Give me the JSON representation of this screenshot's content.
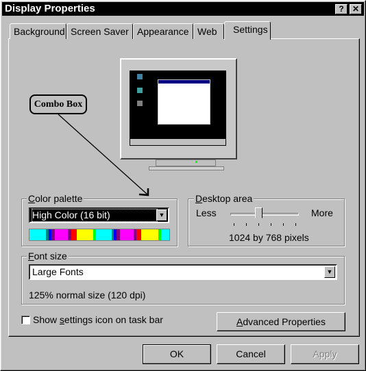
{
  "window": {
    "title": "Display Properties",
    "help_label": "?",
    "close_label": "✕"
  },
  "tabs": [
    {
      "label": "Background"
    },
    {
      "label": "Screen Saver"
    },
    {
      "label": "Appearance"
    },
    {
      "label": "Web"
    },
    {
      "label": "Settings",
      "selected": true
    }
  ],
  "annotation": {
    "callout": "Combo Box"
  },
  "color_palette": {
    "label_u": "C",
    "label_rest": "olor palette",
    "value": "High Color (16 bit)",
    "colors": [
      "#00ffff",
      "#008080",
      "#0000ff",
      "#800080",
      "#ff00ff",
      "#800080",
      "#ff0000",
      "#ffff00",
      "#00ff00",
      "#00ffff",
      "#008080",
      "#0000ff",
      "#800080",
      "#ff00ff",
      "#800080",
      "#ff0000",
      "#ffff00",
      "#00ff00",
      "#00ffff"
    ]
  },
  "desktop_area": {
    "label_u": "D",
    "label_rest": "esktop area",
    "less": "Less",
    "more": "More",
    "slider_value": 0.4,
    "resolution": "1024 by 768 pixels"
  },
  "font_size": {
    "label_u": "F",
    "label_rest": "ont size",
    "value": "Large Fonts",
    "description": "125% normal size (120 dpi)"
  },
  "show_icon": {
    "pre": "Show ",
    "u": "s",
    "post": "ettings icon on task bar",
    "checked": false
  },
  "advanced": {
    "u": "A",
    "rest": "dvanced Properties"
  },
  "buttons": {
    "ok": "OK",
    "cancel": "Cancel",
    "apply": "Apply"
  }
}
